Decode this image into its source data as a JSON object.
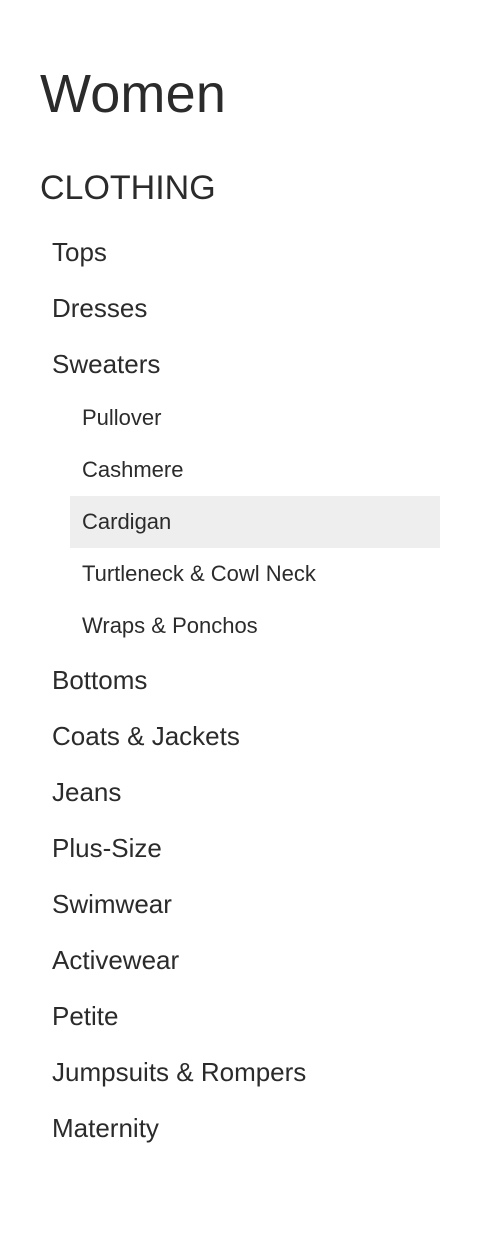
{
  "page_title": "Women",
  "section_heading": "CLOTHING",
  "categories": [
    {
      "label": "Tops"
    },
    {
      "label": "Dresses"
    },
    {
      "label": "Sweaters",
      "expanded": true,
      "subcategories": [
        {
          "label": "Pullover"
        },
        {
          "label": "Cashmere"
        },
        {
          "label": "Cardigan",
          "selected": true
        },
        {
          "label": "Turtleneck & Cowl Neck"
        },
        {
          "label": "Wraps & Ponchos"
        }
      ]
    },
    {
      "label": "Bottoms"
    },
    {
      "label": "Coats & Jackets"
    },
    {
      "label": "Jeans"
    },
    {
      "label": "Plus-Size"
    },
    {
      "label": "Swimwear"
    },
    {
      "label": "Activewear"
    },
    {
      "label": "Petite"
    },
    {
      "label": "Jumpsuits & Rompers"
    },
    {
      "label": "Maternity"
    }
  ],
  "colors": {
    "text": "#2b2b2b",
    "selected_background": "#eeeeee",
    "page_background": "#ffffff"
  }
}
